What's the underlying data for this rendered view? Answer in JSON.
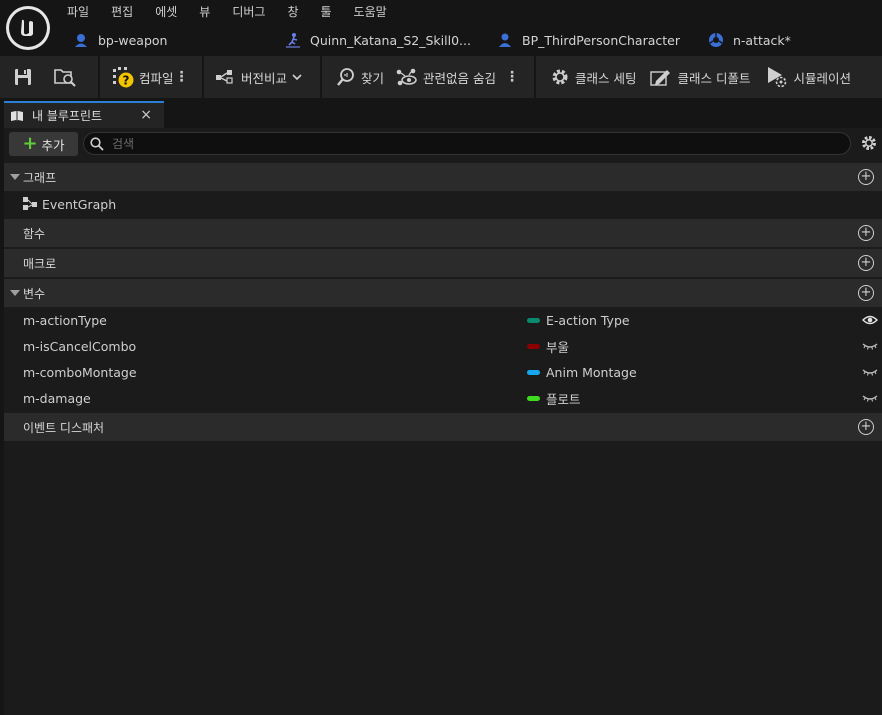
{
  "menu": [
    "파일",
    "편집",
    "에셋",
    "뷰",
    "디버그",
    "창",
    "툴",
    "도움말"
  ],
  "doc_tabs": [
    {
      "label": "bp-weapon",
      "icon": "blueprint-person-icon"
    },
    {
      "label": "Quinn_Katana_S2_Skill0...",
      "icon": "anim-montage-icon"
    },
    {
      "label": "BP_ThirdPersonCharacter",
      "icon": "blueprint-person-icon"
    },
    {
      "label": "n-attack*",
      "icon": "anim-blueprint-icon"
    }
  ],
  "toolbar": {
    "compile": "컴파일",
    "diff": "버전비교",
    "find": "찾기",
    "hide_unrelated": "관련없음 숨김",
    "class_settings": "클래스 세팅",
    "class_defaults": "클래스 디폴트",
    "simulation": "시뮬레이션"
  },
  "panel": {
    "tab_title": "내 블루프린트",
    "close": "×",
    "add_label": "추가",
    "search_placeholder": "검색"
  },
  "sections": {
    "graphs": "그래프",
    "functions": "함수",
    "macros": "매크로",
    "variables": "변수",
    "dispatchers": "이벤트 디스패처"
  },
  "graphs": [
    {
      "label": "EventGraph"
    }
  ],
  "variables": [
    {
      "name": "m-actionType",
      "type": "E-action Type",
      "color": "#0a8a6f",
      "visible": true
    },
    {
      "name": "m-isCancelCombo",
      "type": "부울",
      "color": "#8c0000",
      "visible": false
    },
    {
      "name": "m-comboMontage",
      "type": "Anim Montage",
      "color": "#15a8f0",
      "visible": false
    },
    {
      "name": "m-damage",
      "type": "플로트",
      "color": "#3ddc1f",
      "visible": false
    }
  ]
}
